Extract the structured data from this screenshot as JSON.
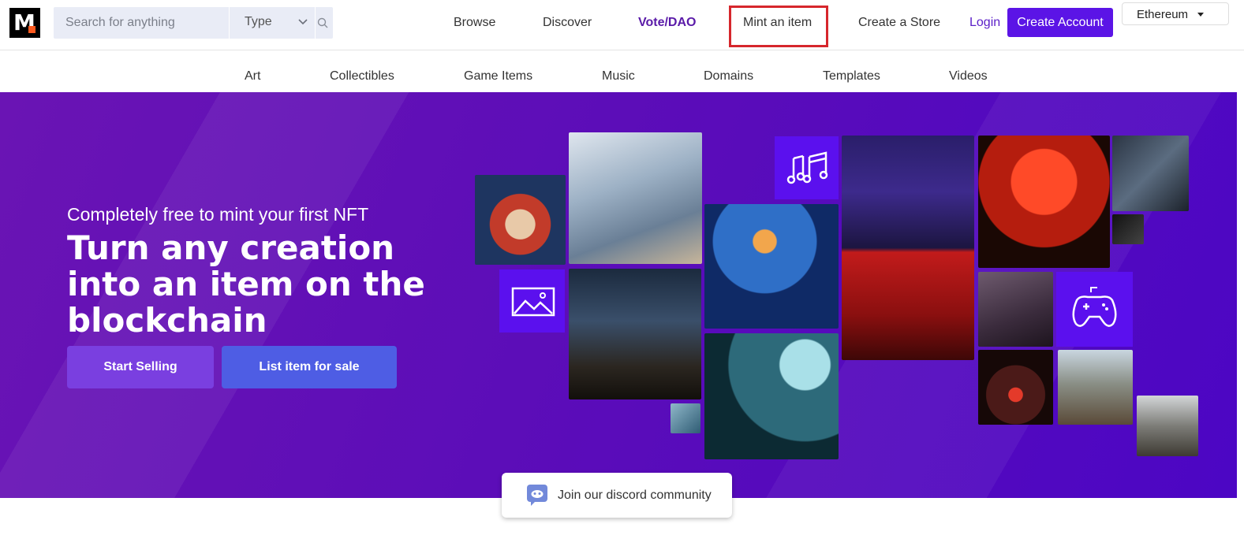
{
  "brand": {
    "logo_letter": "M"
  },
  "search": {
    "placeholder": "Search for anything",
    "type_label": "Type"
  },
  "nav": {
    "browse": "Browse",
    "discover": "Discover",
    "vote": "Vote/DAO",
    "mint": "Mint an item",
    "create_store": "Create a Store",
    "login": "Login",
    "create_account": "Create Account",
    "chain": "Ethereum"
  },
  "categories": [
    "Art",
    "Collectibles",
    "Game Items",
    "Music",
    "Domains",
    "Templates",
    "Videos"
  ],
  "hero": {
    "subtitle": "Completely free to mint your first NFT",
    "headline": "Turn any creation into an item on the blockchain",
    "start_selling": "Start Selling",
    "list_item": "List item for sale"
  },
  "discord": {
    "label": "Join our discord community"
  },
  "colors": {
    "brand_purple": "#5b14e6",
    "hero_bg": "#5c0db8",
    "icon_tile": "#5b10ee",
    "highlight": "#d6262c",
    "logo_accent": "#ff5a1f"
  },
  "icons": [
    "search-icon",
    "chevron-down-icon",
    "music-note-icon",
    "image-icon",
    "gamepad-icon",
    "discord-icon"
  ]
}
